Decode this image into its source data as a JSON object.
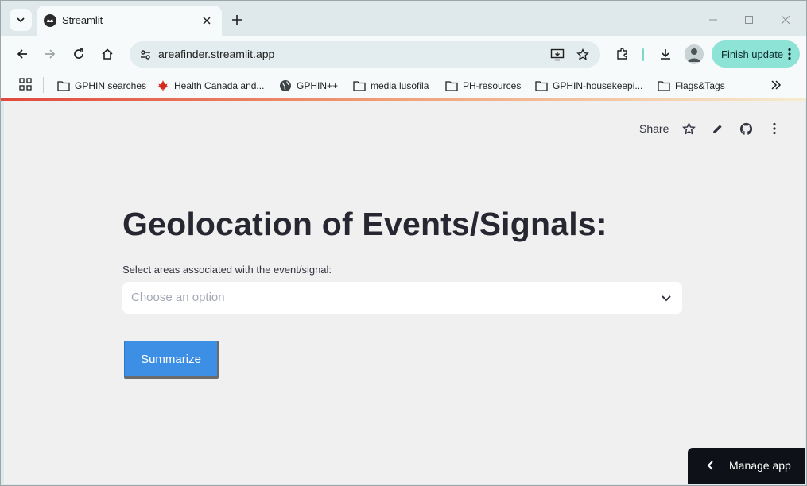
{
  "browser": {
    "tab": {
      "title": "Streamlit"
    },
    "address_bar": {
      "url": "areafinder.streamlit.app"
    },
    "finish_update_label": "Finish update",
    "bookmarks": [
      {
        "label": "GPHIN searches",
        "icon": "folder-icon"
      },
      {
        "label": "Health Canada and...",
        "icon": "maple-leaf-icon"
      },
      {
        "label": "GPHIN++",
        "icon": "globe-icon"
      },
      {
        "label": "media lusofila",
        "icon": "folder-icon"
      },
      {
        "label": "PH-resources",
        "icon": "folder-icon"
      },
      {
        "label": "GPHIN-housekeepi...",
        "icon": "folder-icon"
      },
      {
        "label": "Flags&Tags",
        "icon": "folder-icon"
      }
    ]
  },
  "app": {
    "header": {
      "share_label": "Share"
    },
    "title": "Geolocation of Events/Signals:",
    "select": {
      "label": "Select areas associated with the event/signal:",
      "placeholder": "Choose an option"
    },
    "summarize_label": "Summarize",
    "manage_app_label": "Manage app"
  },
  "colors": {
    "accent_button": "#3d8fe6",
    "finish_update_bg": "#8ee3d7",
    "page_bg": "#f0f0f0",
    "manage_bg": "#0e1117"
  }
}
